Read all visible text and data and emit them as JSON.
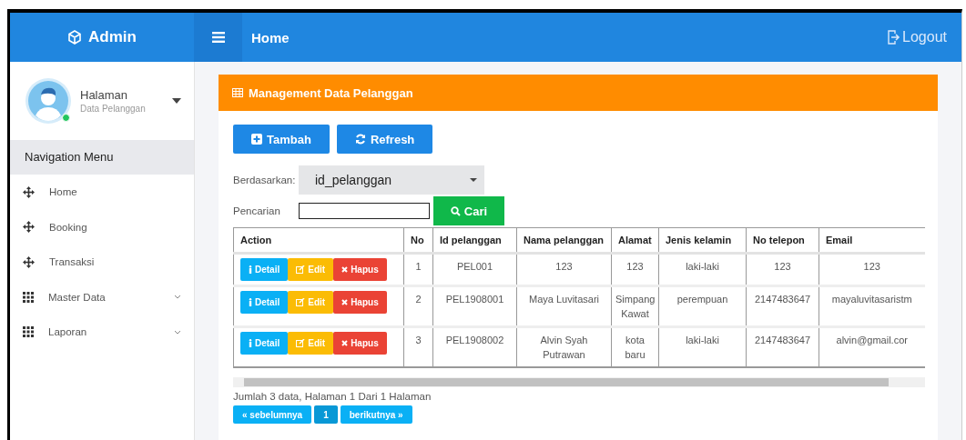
{
  "brand": "Admin",
  "topbar": {
    "title": "Home",
    "logout": "Logout"
  },
  "user": {
    "name": "Halaman",
    "subtitle": "Data Pelanggan",
    "online": true
  },
  "nav_header": "Navigation Menu",
  "nav_items": [
    {
      "label": "Home",
      "kind": "move"
    },
    {
      "label": "Booking",
      "kind": "move"
    },
    {
      "label": "Transaksi",
      "kind": "move"
    },
    {
      "label": "Master Data",
      "kind": "grid",
      "expanded": false
    },
    {
      "label": "Laporan",
      "kind": "grid",
      "expanded": false
    }
  ],
  "card_title": "Management Data Pelanggan",
  "toolbar": [
    {
      "kind": "add",
      "label": "Tambah"
    },
    {
      "kind": "refresh",
      "label": "Refresh"
    }
  ],
  "filter": {
    "label": "Berdasarkan:",
    "value": "id_pelanggan"
  },
  "search": {
    "label": "Pencarian",
    "button": "Cari"
  },
  "table": {
    "columns": [
      "Action",
      "No",
      "Id pelanggan",
      "Nama pelanggan",
      "Alamat",
      "Jenis kelamin",
      "No telepon",
      "Email"
    ],
    "rows": [
      {
        "cells": [
          {
            "actions": [
              {
                "kind": "detail",
                "label": "Detail"
              },
              {
                "kind": "edit",
                "label": "Edit"
              },
              {
                "kind": "delete",
                "label": "Hapus"
              }
            ]
          },
          "1",
          "PEL001",
          "123",
          "123",
          "laki-laki",
          "123",
          "123"
        ]
      },
      {
        "cells": [
          {
            "actions": [
              {
                "kind": "detail",
                "label": "Detail"
              },
              {
                "kind": "edit",
                "label": "Edit"
              },
              {
                "kind": "delete",
                "label": "Hapus"
              }
            ]
          },
          "2",
          "PEL1908001",
          "Maya Luvitasari",
          "Simpang Kawat",
          "perempuan",
          "2147483647",
          "mayaluvitasaristm"
        ]
      },
      {
        "cells": [
          {
            "actions": [
              {
                "kind": "detail",
                "label": "Detail"
              },
              {
                "kind": "edit",
                "label": "Edit"
              },
              {
                "kind": "delete",
                "label": "Hapus"
              }
            ]
          },
          "3",
          "PEL1908002",
          "Alvin Syah Putrawan",
          "kota baru",
          "laki-laki",
          "2147483647",
          "alvin@gmail.cor"
        ]
      }
    ]
  },
  "summary": "Jumlah 3 data, Halaman 1 Dari 1 Halaman",
  "pagination": [
    {
      "label": "« sebelumnya",
      "selected": false
    },
    {
      "label": "1",
      "selected": true
    },
    {
      "label": "berikutnya »",
      "selected": false
    }
  ]
}
